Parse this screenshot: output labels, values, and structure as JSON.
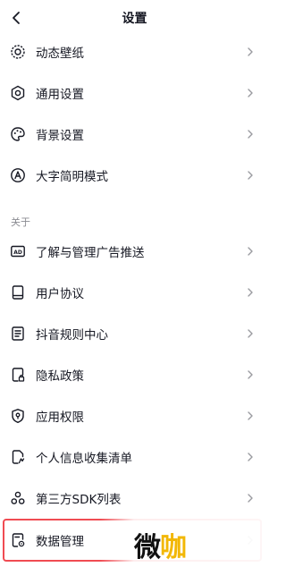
{
  "header": {
    "title": "设置",
    "back_icon": "chevron-left-icon"
  },
  "items_top": [
    {
      "label": "动态壁纸",
      "icon": "live-wallpaper-icon"
    },
    {
      "label": "通用设置",
      "icon": "gear-icon"
    },
    {
      "label": "背景设置",
      "icon": "palette-icon"
    },
    {
      "label": "大字简明模式",
      "icon": "large-font-icon"
    }
  ],
  "about": {
    "section_title": "关于",
    "items": [
      {
        "label": "了解与管理广告推送",
        "icon": "ad-icon"
      },
      {
        "label": "用户协议",
        "icon": "book-icon"
      },
      {
        "label": "抖音规则中心",
        "icon": "rules-doc-icon"
      },
      {
        "label": "隐私政策",
        "icon": "privacy-doc-icon"
      },
      {
        "label": "应用权限",
        "icon": "shield-icon"
      },
      {
        "label": "个人信息收集清单",
        "icon": "info-doc-icon"
      },
      {
        "label": "第三方SDK列表",
        "icon": "sdk-icon"
      },
      {
        "label": "数据管理",
        "icon": "data-manage-icon"
      }
    ]
  },
  "watermark": {
    "text_main": "微",
    "text_accent": "咖"
  },
  "colors": {
    "text": "#161823",
    "secondary": "#8a8b91",
    "highlight_border": "#f04b52",
    "watermark_accent": "#f2b705"
  }
}
